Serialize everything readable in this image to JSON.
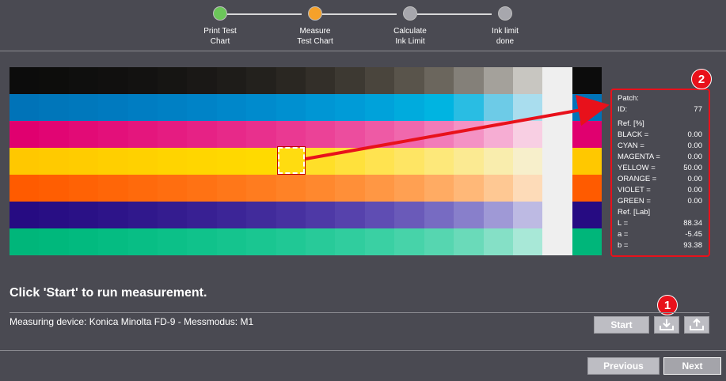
{
  "stepper": {
    "steps": [
      {
        "label": "Print Test\nChart",
        "state": "done",
        "color": "#6cc65a"
      },
      {
        "label": "Measure\nTest Chart",
        "state": "active",
        "color": "#f5a12a"
      },
      {
        "label": "Calculate\nInk Limit",
        "state": "pending",
        "color": "#a7a7ad"
      },
      {
        "label": "Ink limit\ndone",
        "state": "pending",
        "color": "#a7a7ad"
      }
    ]
  },
  "chart": {
    "rows": [
      {
        "name": "black",
        "cells": [
          "#0c0c0c",
          "#0d0d0c",
          "#0f0f0e",
          "#11100f",
          "#131211",
          "#161513",
          "#1a1816",
          "#1e1c19",
          "#23211d",
          "#2a2722",
          "#332f29",
          "#3d3932",
          "#4a453d",
          "#59544b",
          "#6b665d",
          "#848079",
          "#a4a19b",
          "#c8c6c1",
          "#efefef",
          "#0c0c0c"
        ]
      },
      {
        "name": "cyan",
        "cells": [
          "#0073b8",
          "#0076ba",
          "#0078bc",
          "#007abf",
          "#007dc2",
          "#0080c4",
          "#0083c7",
          "#0087ca",
          "#008bcd",
          "#0090d0",
          "#0096d4",
          "#009bd7",
          "#00a2da",
          "#00abdd",
          "#00b4e1",
          "#29bde3",
          "#6dcbe7",
          "#a9ddee",
          "#efefef",
          "#0073b8"
        ]
      },
      {
        "name": "magenta",
        "cells": [
          "#e0006f",
          "#e10573",
          "#e20b76",
          "#e3107a",
          "#e4167d",
          "#e51c81",
          "#e62285",
          "#e72989",
          "#e8308d",
          "#ea3992",
          "#eb4297",
          "#ec4d9e",
          "#ee5aa5",
          "#f068ad",
          "#f27bb8",
          "#f492c4",
          "#f6add3",
          "#f8cfe3",
          "#efefef",
          "#e0006f"
        ]
      },
      {
        "name": "yellow",
        "cells": [
          "#ffc800",
          "#ffca00",
          "#ffcc00",
          "#ffcf00",
          "#ffd100",
          "#ffd400",
          "#ffd600",
          "#ffd800",
          "#ffda00",
          "#ffdc10",
          "#ffdf28",
          "#ffe13c",
          "#ffe350",
          "#fee564",
          "#fde87a",
          "#fbea92",
          "#f9edad",
          "#f7efcb",
          "#efefef",
          "#ffc800"
        ]
      },
      {
        "name": "orange",
        "cells": [
          "#ff5b00",
          "#ff5e02",
          "#ff6205",
          "#ff6608",
          "#ff6a0c",
          "#ff6e10",
          "#ff7214",
          "#ff7719",
          "#ff7c1f",
          "#ff8226",
          "#ff882e",
          "#ff8f38",
          "#ff9744",
          "#ffa052",
          "#ffab63",
          "#ffb878",
          "#fec893",
          "#fddbb8",
          "#efefef",
          "#ff5b00"
        ]
      },
      {
        "name": "violet",
        "cells": [
          "#260b82",
          "#280e84",
          "#2a1186",
          "#2d1489",
          "#30188c",
          "#341c8f",
          "#382093",
          "#3c2597",
          "#412b9b",
          "#4731a0",
          "#4e39a6",
          "#5642ac",
          "#5f4db3",
          "#6a5ab9",
          "#776bc2",
          "#887fcb",
          "#9f99d6",
          "#bdbae3",
          "#efefef",
          "#260b82"
        ]
      },
      {
        "name": "green",
        "cells": [
          "#00b67a",
          "#00b87c",
          "#02ba7f",
          "#05bc82",
          "#08be85",
          "#0cc088",
          "#10c28b",
          "#15c48e",
          "#1ac691",
          "#20c895",
          "#28ca99",
          "#30cd9e",
          "#3ad0a3",
          "#47d3a9",
          "#56d6b0",
          "#6adab9",
          "#85e0c6",
          "#a8e8d7",
          "#efefef",
          "#00b67a"
        ]
      }
    ]
  },
  "patch_panel": {
    "title": "Patch:",
    "id_label": "ID:",
    "id_value": "77",
    "ref_pct_title": "Ref. [%]",
    "ref_pct": [
      {
        "label": "BLACK =",
        "value": "0.00"
      },
      {
        "label": "CYAN =",
        "value": "0.00"
      },
      {
        "label": "MAGENTA =",
        "value": "0.00"
      },
      {
        "label": "YELLOW =",
        "value": "50.00"
      },
      {
        "label": "ORANGE =",
        "value": "0.00"
      },
      {
        "label": "VIOLET =",
        "value": "0.00"
      },
      {
        "label": "GREEN =",
        "value": "0.00"
      }
    ],
    "ref_lab_title": "Ref. [Lab]",
    "ref_lab": [
      {
        "label": "L =",
        "value": "88.34"
      },
      {
        "label": "a =",
        "value": "-5.45"
      },
      {
        "label": "b =",
        "value": "93.38"
      }
    ]
  },
  "callouts": {
    "badge_1": "1",
    "badge_2": "2"
  },
  "instruction": "Click 'Start' to run measurement.",
  "device_info": "Measuring device: Konica Minolta FD-9   -   Messmodus: M1",
  "buttons": {
    "start": "Start",
    "import_icon": "download-tray-icon",
    "export_icon": "upload-tray-icon",
    "previous": "Previous",
    "next": "Next"
  },
  "colors": {
    "highlight": "#e8111b",
    "background": "#4a4a52"
  }
}
